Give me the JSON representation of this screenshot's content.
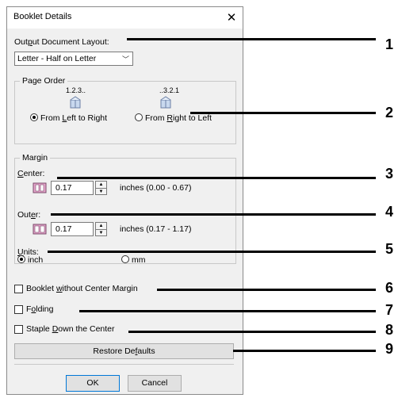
{
  "dialog": {
    "title": "Booklet Details",
    "close_glyph": "✕",
    "output_layout": {
      "label_pre": "Out",
      "label_u": "p",
      "label_post": "ut Document Layout:",
      "value": "Letter - Half on Letter",
      "arrow": "﹀"
    },
    "page_order": {
      "legend": "Page Order",
      "left_seq": "1.2.3..",
      "right_seq": "..3.2.1",
      "option_left_pre": "From ",
      "option_left_u": "L",
      "option_left_post": "eft to Right",
      "option_right_pre": "From ",
      "option_right_u": "R",
      "option_right_post": "ight to Left",
      "selected": "left"
    },
    "margin": {
      "legend": "Margin",
      "center_label_u": "C",
      "center_label_rest": "enter:",
      "center_value": "0.17",
      "center_range": "inches (0.00 - 0.67)",
      "outer_label_pre": "Out",
      "outer_label_u": "e",
      "outer_label_post": "r:",
      "outer_value": "0.17",
      "outer_range": "inches (0.17 - 1.17)",
      "units_label_u": "U",
      "units_label_rest": "nits:",
      "unit_inch": "inch",
      "unit_mm": "mm",
      "selected_unit": "inch"
    },
    "checkboxes": {
      "booklet_pre": "Booklet ",
      "booklet_u": "w",
      "booklet_post": "ithout Center Margin",
      "folding_pre": "F",
      "folding_u": "o",
      "folding_post": "lding",
      "staple_pre": "Staple ",
      "staple_u": "D",
      "staple_post": "own the Center"
    },
    "restore_pre": "Restore De",
    "restore_u": "f",
    "restore_post": "aults",
    "ok_label": "OK",
    "cancel_label": "Cancel"
  },
  "callouts": [
    "1",
    "2",
    "3",
    "4",
    "5",
    "6",
    "7",
    "8",
    "9"
  ],
  "colors": {
    "book_fill": "#c8d8ee",
    "book_edge": "#6b7fa6",
    "pink_icon": "#e6a6cc"
  }
}
